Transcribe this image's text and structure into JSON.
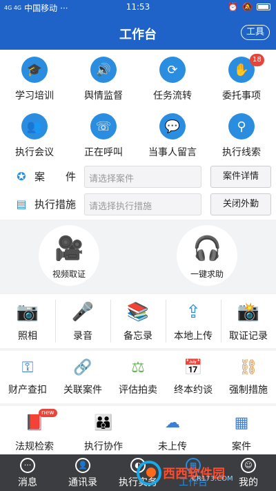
{
  "status_bar": {
    "signal": "4G 4G",
    "carrier": "中国移动",
    "dots": "···",
    "time": "11:53"
  },
  "header": {
    "title": "工作台",
    "tool_button": "工具"
  },
  "top_grid": [
    {
      "label": "学习培训",
      "icon": "graduation-cap-icon",
      "glyph": "🎓"
    },
    {
      "label": "舆情监督",
      "icon": "speaker-icon",
      "glyph": "🔊"
    },
    {
      "label": "任务流转",
      "icon": "refresh-icon",
      "glyph": "⟳"
    },
    {
      "label": "委托事项",
      "icon": "hand-icon",
      "glyph": "✋",
      "badge": "18"
    },
    {
      "label": "执行会议",
      "icon": "people-icon",
      "glyph": "👥"
    },
    {
      "label": "正在呼叫",
      "icon": "phone-icon",
      "glyph": "☏"
    },
    {
      "label": "当事人留言",
      "icon": "chat-icon",
      "glyph": "💬"
    },
    {
      "label": "执行线索",
      "icon": "clue-icon",
      "glyph": "⚲"
    }
  ],
  "case_row": {
    "label": "案　　件",
    "placeholder": "请选择案件",
    "button": "案件详情"
  },
  "measure_row": {
    "label": "执行措施",
    "placeholder": "请选择执行措施",
    "button": "关闭外勤"
  },
  "big_buttons": [
    {
      "label": "视频取证",
      "icon": "video-camera-icon",
      "glyph": "🎥"
    },
    {
      "label": "一键求助",
      "icon": "headset-icon",
      "glyph": "🎧"
    }
  ],
  "tools_row": [
    {
      "label": "照相",
      "icon": "camera-icon",
      "glyph": "📷"
    },
    {
      "label": "录音",
      "icon": "microphone-icon",
      "glyph": "🎤"
    },
    {
      "label": "备忘录",
      "icon": "books-icon",
      "glyph": "📚"
    },
    {
      "label": "本地上传",
      "icon": "upload-icon",
      "glyph": "⇪"
    },
    {
      "label": "取证记录",
      "icon": "evidence-icon",
      "glyph": "📸"
    }
  ],
  "action_row": [
    {
      "label": "财产查扣",
      "icon": "property-icon",
      "glyph": "⚿",
      "color": "#3b7fd4"
    },
    {
      "label": "关联案件",
      "icon": "link-icon",
      "glyph": "🔗",
      "color": "#e6a93a"
    },
    {
      "label": "评估拍卖",
      "icon": "auction-icon",
      "glyph": "⚖",
      "color": "#6bb55a"
    },
    {
      "label": "终本约谈",
      "icon": "talk-icon",
      "glyph": "📅",
      "color": "#8bbf6a"
    },
    {
      "label": "强制措施",
      "icon": "handcuff-icon",
      "glyph": "⛓",
      "color": "#d9822b"
    }
  ],
  "bottom_row": [
    {
      "label": "法规检索",
      "icon": "law-book-icon",
      "glyph": "📕",
      "color": "#e6a93a",
      "new": "new"
    },
    {
      "label": "执行协作",
      "icon": "team-icon",
      "glyph": "👪",
      "color": "#3b7fd4"
    },
    {
      "label": "未上传",
      "icon": "cloud-icon",
      "glyph": "☁",
      "color": "#3b7fd4"
    },
    {
      "label": "案件",
      "icon": "grid-icon",
      "glyph": "▦",
      "color": "#3b7fd4"
    }
  ],
  "tabbar": [
    {
      "label": "消息",
      "glyph": "···",
      "icon": "message-icon",
      "active": false
    },
    {
      "label": "通讯录",
      "glyph": "👤",
      "icon": "contacts-icon",
      "active": false
    },
    {
      "label": "执行实务",
      "glyph": "◐",
      "icon": "practice-icon",
      "active": false
    },
    {
      "label": "工作台",
      "glyph": "▦",
      "icon": "workbench-icon",
      "active": true
    },
    {
      "label": "我的",
      "glyph": "☺",
      "icon": "profile-icon",
      "active": false
    }
  ],
  "watermark": {
    "brand": "西西软件园",
    "site": "CR173.COM"
  },
  "colors": {
    "brand_blue": "#1f63c9",
    "icon_blue": "#2b8de0",
    "badge_red": "#e6453a",
    "tabbar_bg": "#3b3d40"
  }
}
